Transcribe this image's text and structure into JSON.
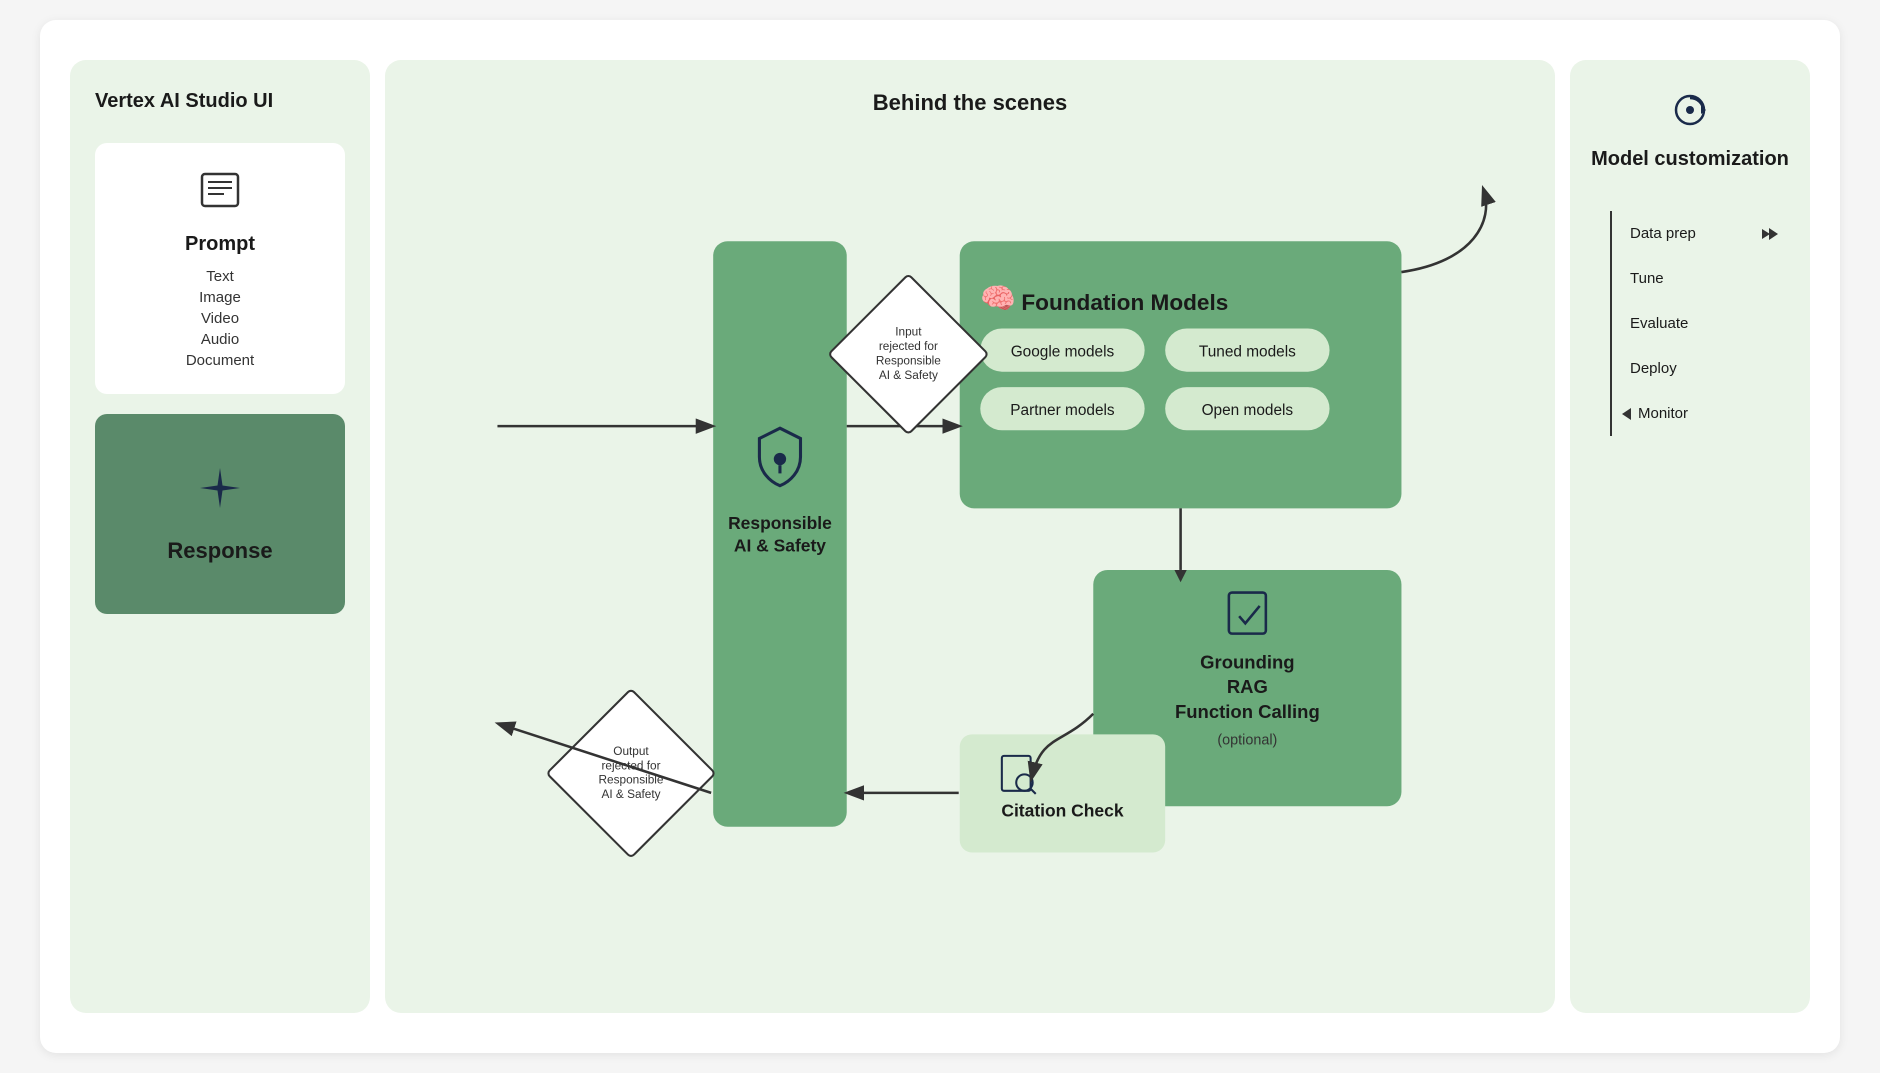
{
  "leftPanel": {
    "title": "Vertex AI Studio UI",
    "promptCard": {
      "title": "Prompt",
      "items": [
        "Text",
        "Image",
        "Video",
        "Audio",
        "Document"
      ]
    },
    "responseCard": {
      "title": "Response"
    }
  },
  "middlePanel": {
    "title": "Behind the scenes",
    "inputDiamond": {
      "text": "Input rejected for Responsible AI & Safety"
    },
    "outputDiamond": {
      "text": "Output rejected for Responsible AI & Safety"
    },
    "responsibleAI": {
      "label1": "Responsible",
      "label2": "AI & Safety"
    },
    "foundationModels": {
      "title": "Foundation Models",
      "chips": [
        "Google models",
        "Tuned models",
        "Partner models",
        "Open models"
      ]
    },
    "grounding": {
      "title": "Grounding\nRAG\nFunction Calling",
      "optional": "(optional)"
    },
    "citationCheck": {
      "title": "Citation Check"
    }
  },
  "rightPanel": {
    "title": "Model customization",
    "steps": [
      "Data prep",
      "Tune",
      "Evaluate",
      "Deploy",
      "Monitor"
    ]
  },
  "colors": {
    "lightGreen": "#eaf4e8",
    "medGreen": "#6aaa7a",
    "chipGreen": "#d4eacf",
    "navy": "#1a2a4a",
    "dark": "#1a1a1a",
    "border": "#333"
  }
}
